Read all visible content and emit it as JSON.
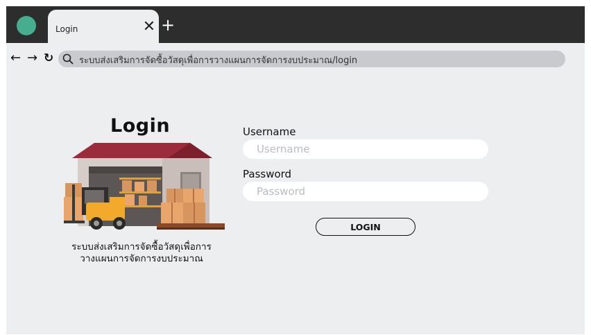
{
  "browser": {
    "tab_title": "Login",
    "tab_close": "✕",
    "new_tab": "+",
    "back": "←",
    "forward": "→",
    "reload": "↻",
    "address": "ระบบส่งเสริมการจัดซื้อวัสดุเพื่อการวางแผนการจัดการงบประมาณ/login"
  },
  "login": {
    "title": "Login",
    "caption_line1": "ระบบส่งเสริมการจัดซื้อวัสดุเพื่อการ",
    "caption_line2": "วางแผนการจัดการงบประมาณ",
    "username_label": "Username",
    "username_placeholder": "Username",
    "username_value": "",
    "password_label": "Password",
    "password_placeholder": "Password",
    "password_value": "",
    "button_label": "LOGIN"
  },
  "icons": {
    "profile": "profile-avatar",
    "search": "search-icon",
    "illustration": "warehouse-forklift-illustration"
  },
  "colors": {
    "tabbar": "#2d2d2d",
    "page_bg": "#eceef0",
    "profile": "#46ad8e",
    "address_bg": "#c8cace",
    "roof": "#9a2c3b",
    "forklift": "#f2a92c",
    "boxes": "#e8a66c"
  }
}
